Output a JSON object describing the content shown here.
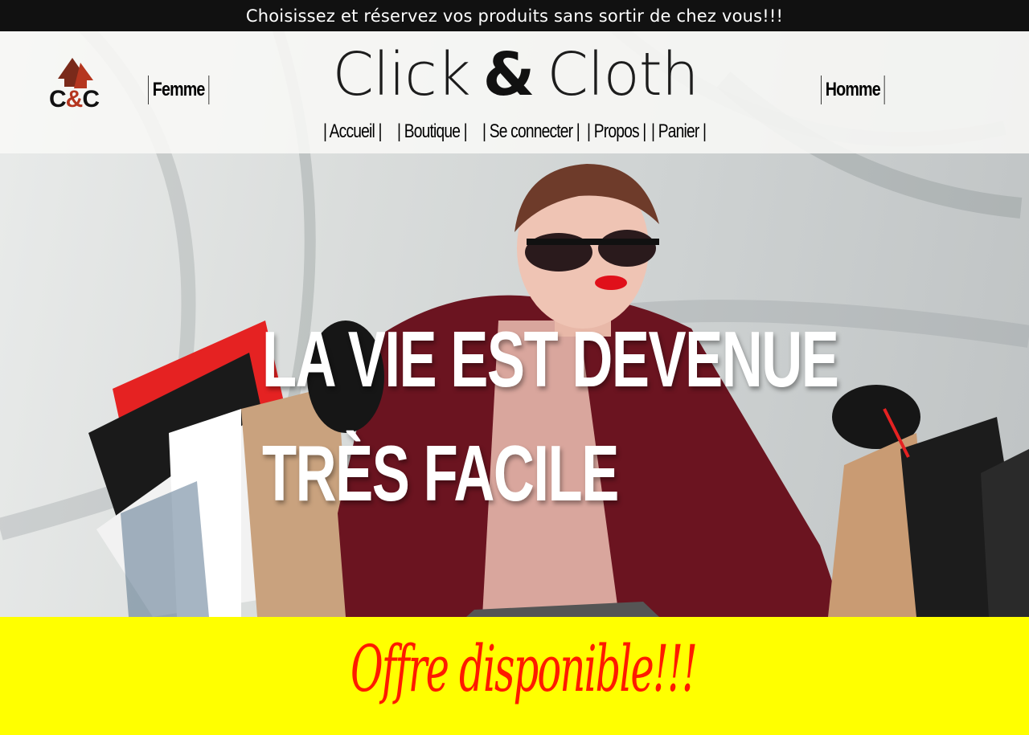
{
  "topbar": {
    "text": "Choisissez et réservez vos produits sans sortir de chez vous!!!"
  },
  "logo": {
    "left": "C",
    "amp": "&",
    "right": "C",
    "icon": "double-arrow-up-icon",
    "accent": "#b5361f"
  },
  "brand": {
    "part1": "Click",
    "amp": "&",
    "part2": "Cloth"
  },
  "categories": {
    "left": "Femme",
    "right": "Homme"
  },
  "nav": {
    "items": [
      {
        "label": "| Accueil |"
      },
      {
        "label": "| Boutique |"
      },
      {
        "label": "| Se connecter |"
      },
      {
        "label": "| Propos |"
      },
      {
        "label": "| Panier |"
      }
    ]
  },
  "hero": {
    "line1": "LA VIE EST DEVENUE",
    "line2": "TRÈS FACILE"
  },
  "offer": {
    "text": "Offre disponible!!!",
    "background": "#ffff00",
    "color": "#ff1a00"
  }
}
